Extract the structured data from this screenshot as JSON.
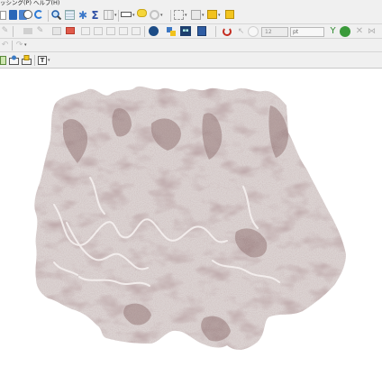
{
  "menubar": {
    "items": [
      {
        "label": "ッシング(P)"
      },
      {
        "label": "ヘルプ(H)"
      }
    ]
  },
  "toolbar2": {
    "font_size_value": "12",
    "unit_value": "pt"
  },
  "colors": {
    "toolbar_bg": "#f0f0f0",
    "map_dark": "#8e6f6f",
    "map_light": "#d9d1d0"
  },
  "icons": {
    "row1": [
      "new-file-icon",
      "save-icon",
      "save-as-icon",
      "clock-icon",
      "refresh-icon",
      "zoom-icon",
      "table-icon",
      "gear-icon",
      "sigma-icon",
      "grid-icon",
      "ruler-icon",
      "tooltip-icon",
      "settings-icon",
      "grid-select-icon",
      "layers-icon",
      "label-icon"
    ],
    "row2": [
      "pencil-icon",
      "edit-icon",
      "digitize-icon",
      "vertex-icon",
      "delete-icon",
      "node-tool-icon",
      "cut-icon",
      "copy-icon",
      "paste-icon",
      "undo-icon",
      "redo-icon",
      "label-pin-icon",
      "python-icon",
      "plugin-icon",
      "manager-icon",
      "book-icon",
      "magnet-icon",
      "pointer-icon",
      "branch-icon",
      "globe-plugin-icon",
      "close-x-icon",
      "move-icon"
    ],
    "row3": [
      "undo-icon",
      "redo-icon"
    ],
    "row4": [
      "layer-add-icon",
      "layer-pin-icon",
      "layer-text-icon",
      "text-box-icon"
    ]
  }
}
